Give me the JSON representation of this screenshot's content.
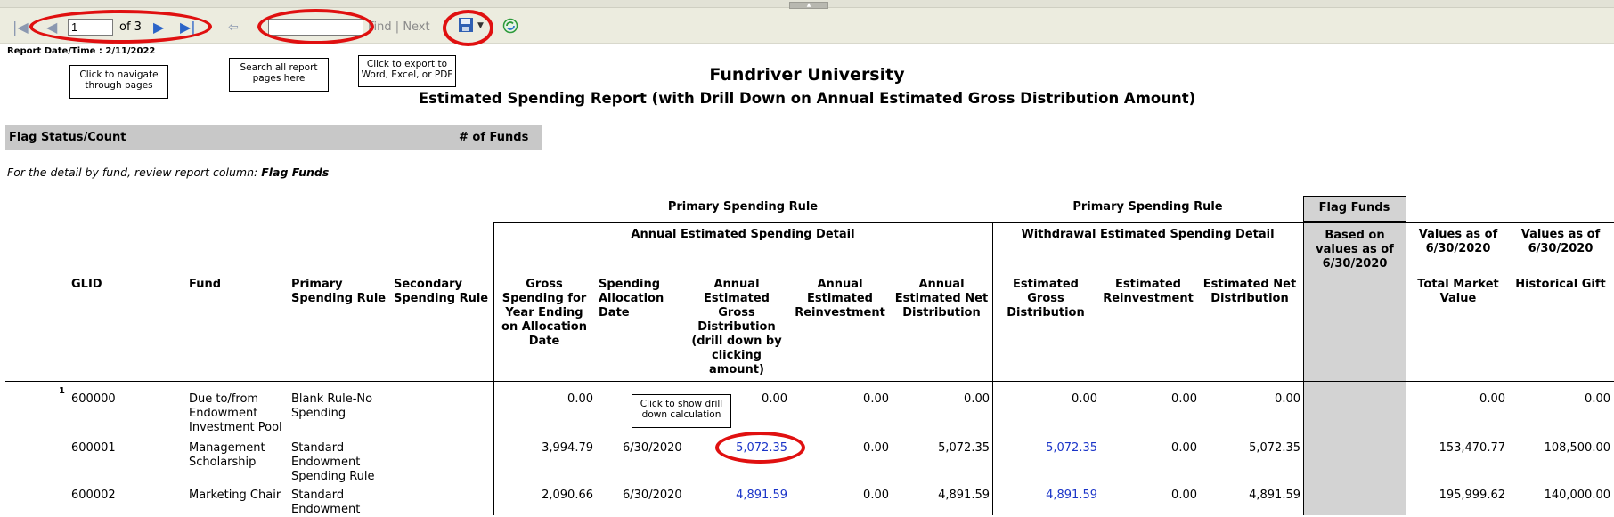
{
  "toolbar": {
    "page_value": "1",
    "page_of": "of 3",
    "find_label": "Find",
    "separator": "|",
    "next_label": "Next",
    "icons": [
      "first-page-icon",
      "previous-page-icon",
      "next-page-icon",
      "last-page-icon",
      "back-icon",
      "export-save-icon",
      "dropdown-arrow-icon",
      "refresh-icon"
    ]
  },
  "callouts": {
    "navigate": "Click to navigate through pages",
    "search": "Search all report pages here",
    "export": "Click to export to Word, Excel, or PDF",
    "drill": "Click to show drill down calculation"
  },
  "report": {
    "date_label": "Report Date/Time : 2/11/2022",
    "university": "Fundriver University",
    "title": "Estimated Spending Report (with Drill Down on Annual Estimated Gross Distribution Amount)",
    "flag_status": "Flag Status/Count",
    "num_funds": "# of Funds",
    "note_prefix": "For the detail by fund, review report column: ",
    "note_bold": "Flag Funds"
  },
  "groups": {
    "primary_rule_1": "Primary Spending Rule",
    "primary_rule_2": "Primary Spending Rule",
    "flag_funds": "Flag Funds",
    "annual_detail": "Annual Estimated Spending Detail",
    "withdrawal_detail": "Withdrawal Estimated Spending Detail",
    "based_on": "Based on values as of 6/30/2020",
    "values_as_of_1": "Values as of 6/30/2020",
    "values_as_of_2": "Values as of 6/30/2020"
  },
  "columns": {
    "glid": "GLID",
    "fund": "Fund",
    "primary": "Primary Spending Rule",
    "secondary": "Secondary Spending Rule",
    "gross_spending": "Gross Spending for Year Ending on Allocation Date",
    "alloc_date": "Spending Allocation Date",
    "annual_gross": "Annual Estimated Gross Distribution (drill down by clicking amount)",
    "annual_reinvest": "Annual Estimated Reinvestment",
    "annual_net": "Annual Estimated Net Distribution",
    "est_gross": "Estimated Gross Distribution",
    "est_reinvest": "Estimated Reinvestment",
    "est_net": "Estimated Net Distribution",
    "total_market": "Total Market Value",
    "hist_gift": "Historical Gift"
  },
  "rows": [
    {
      "group_no": "1",
      "glid": "600000",
      "fund": "Due to/from Endowment Investment Pool",
      "primary": "Blank Rule-No Spending",
      "secondary": "",
      "gross_spending": "0.00",
      "alloc_date": "",
      "annual_gross": "0.00",
      "annual_reinvest": "0.00",
      "annual_net": "0.00",
      "est_gross": "0.00",
      "est_reinvest": "0.00",
      "est_net": "0.00",
      "total_market": "0.00",
      "hist_gift": "0.00"
    },
    {
      "group_no": "",
      "glid": "600001",
      "fund": "Management Scholarship",
      "primary": "Standard Endowment Spending Rule",
      "secondary": "",
      "gross_spending": "3,994.79",
      "alloc_date": "6/30/2020",
      "annual_gross": "5,072.35",
      "annual_reinvest": "0.00",
      "annual_net": "5,072.35",
      "est_gross": "5,072.35",
      "est_reinvest": "0.00",
      "est_net": "5,072.35",
      "total_market": "153,470.77",
      "hist_gift": "108,500.00"
    },
    {
      "group_no": "",
      "glid": "600002",
      "fund": "Marketing Chair",
      "primary": "Standard Endowment",
      "secondary": "",
      "gross_spending": "2,090.66",
      "alloc_date": "6/30/2020",
      "annual_gross": "4,891.59",
      "annual_reinvest": "0.00",
      "annual_net": "4,891.59",
      "est_gross": "4,891.59",
      "est_reinvest": "0.00",
      "est_net": "4,891.59",
      "total_market": "195,999.62",
      "hist_gift": "140,000.00"
    }
  ],
  "colors": {
    "highlight": "#e01010",
    "link": "#1a34c8",
    "flag_grey": "#d3d3d3"
  }
}
